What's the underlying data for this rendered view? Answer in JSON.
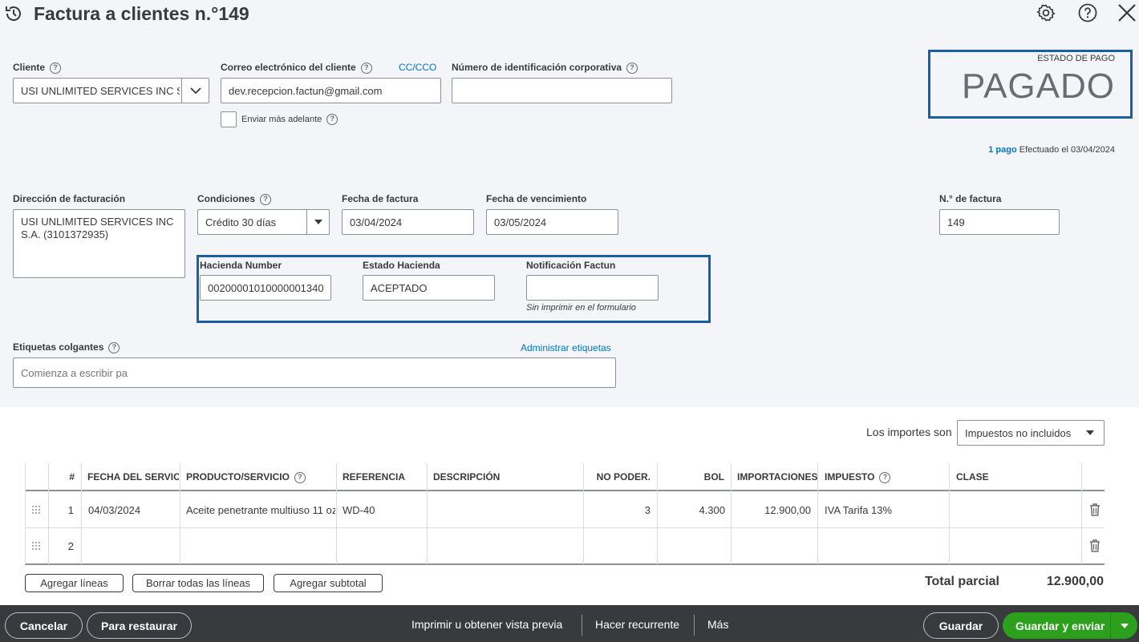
{
  "header": {
    "title": "Factura a clientes n.°149"
  },
  "customer": {
    "label": "Cliente",
    "value": "USI UNLIMITED SERVICES INC S.A."
  },
  "email": {
    "label": "Correo electrónico del cliente",
    "cc_link": "CC/CCO",
    "value": "dev.recepcion.factun@gmail.com",
    "send_later_label": "Enviar más adelante"
  },
  "corp_id": {
    "label": "Número de identificación corporativa",
    "value": ""
  },
  "payment_status": {
    "label": "ESTADO DE PAGO",
    "value": "PAGADO",
    "payments_link": "1 pago",
    "payments_text": "Efectuado el 03/04/2024"
  },
  "billing": {
    "label": "Dirección de facturación",
    "value": "USI UNLIMITED SERVICES INC S.A. (3101372935)"
  },
  "terms": {
    "label": "Condiciones",
    "value": "Crédito 30 días"
  },
  "invoice_date": {
    "label": "Fecha de factura",
    "value": "03/04/2024"
  },
  "due_date": {
    "label": "Fecha de vencimiento",
    "value": "03/05/2024"
  },
  "invoice_no": {
    "label": "N.° de factura",
    "value": "149"
  },
  "custom_fields": {
    "hacienda_number_label": "Hacienda Number",
    "hacienda_number_value": "00200001010000001340",
    "estado_label": "Estado Hacienda",
    "estado_value": "ACEPTADO",
    "notificacion_label": "Notificación Factun",
    "notificacion_value": "",
    "notificacion_note": "Sin imprimir en el formulario"
  },
  "tags": {
    "label": "Etiquetas colgantes",
    "manage_link": "Administrar etiquetas",
    "placeholder": "Comienza a escribir pa"
  },
  "amounts": {
    "label": "Los importes son",
    "value": "Impuestos no incluidos"
  },
  "table": {
    "headers": [
      "#",
      "FECHA DEL SERVICIO",
      "PRODUCTO/SERVICIO",
      "REFERENCIA",
      "DESCRIPCIÓN",
      "NO PODER.",
      "BOL",
      "IMPORTACIONES",
      "IMPUESTO",
      "CLASE"
    ],
    "rows": [
      {
        "num": "1",
        "date": "04/03/2024",
        "product": "Aceite penetrante multiuso 11 oz",
        "ref": "WD-40",
        "desc": "",
        "qty": "3",
        "rate": "4.300",
        "amount": "12.900,00",
        "tax": "IVA Tarifa 13%",
        "class": ""
      },
      {
        "num": "2",
        "date": "",
        "product": "",
        "ref": "",
        "desc": "",
        "qty": "",
        "rate": "",
        "amount": "",
        "tax": "",
        "class": ""
      }
    ]
  },
  "table_actions": {
    "add_lines": "Agregar líneas",
    "clear_lines": "Borrar todas las líneas",
    "add_subtotal": "Agregar subtotal"
  },
  "totals": {
    "subtotal_label": "Total parcial",
    "subtotal_value": "12.900,00"
  },
  "footer": {
    "cancel": "Cancelar",
    "revert": "Para restaurar",
    "print": "Imprimir u obtener vista previa",
    "recurring": "Hacer recurrente",
    "more": "Más",
    "save": "Guardar",
    "save_send": "Guardar y enviar"
  },
  "colors": {
    "accent": "#0077c5",
    "highlight_box": "#1a5fa3",
    "primary_button": "#2ca01c",
    "footer_bg": "#393a3d"
  }
}
